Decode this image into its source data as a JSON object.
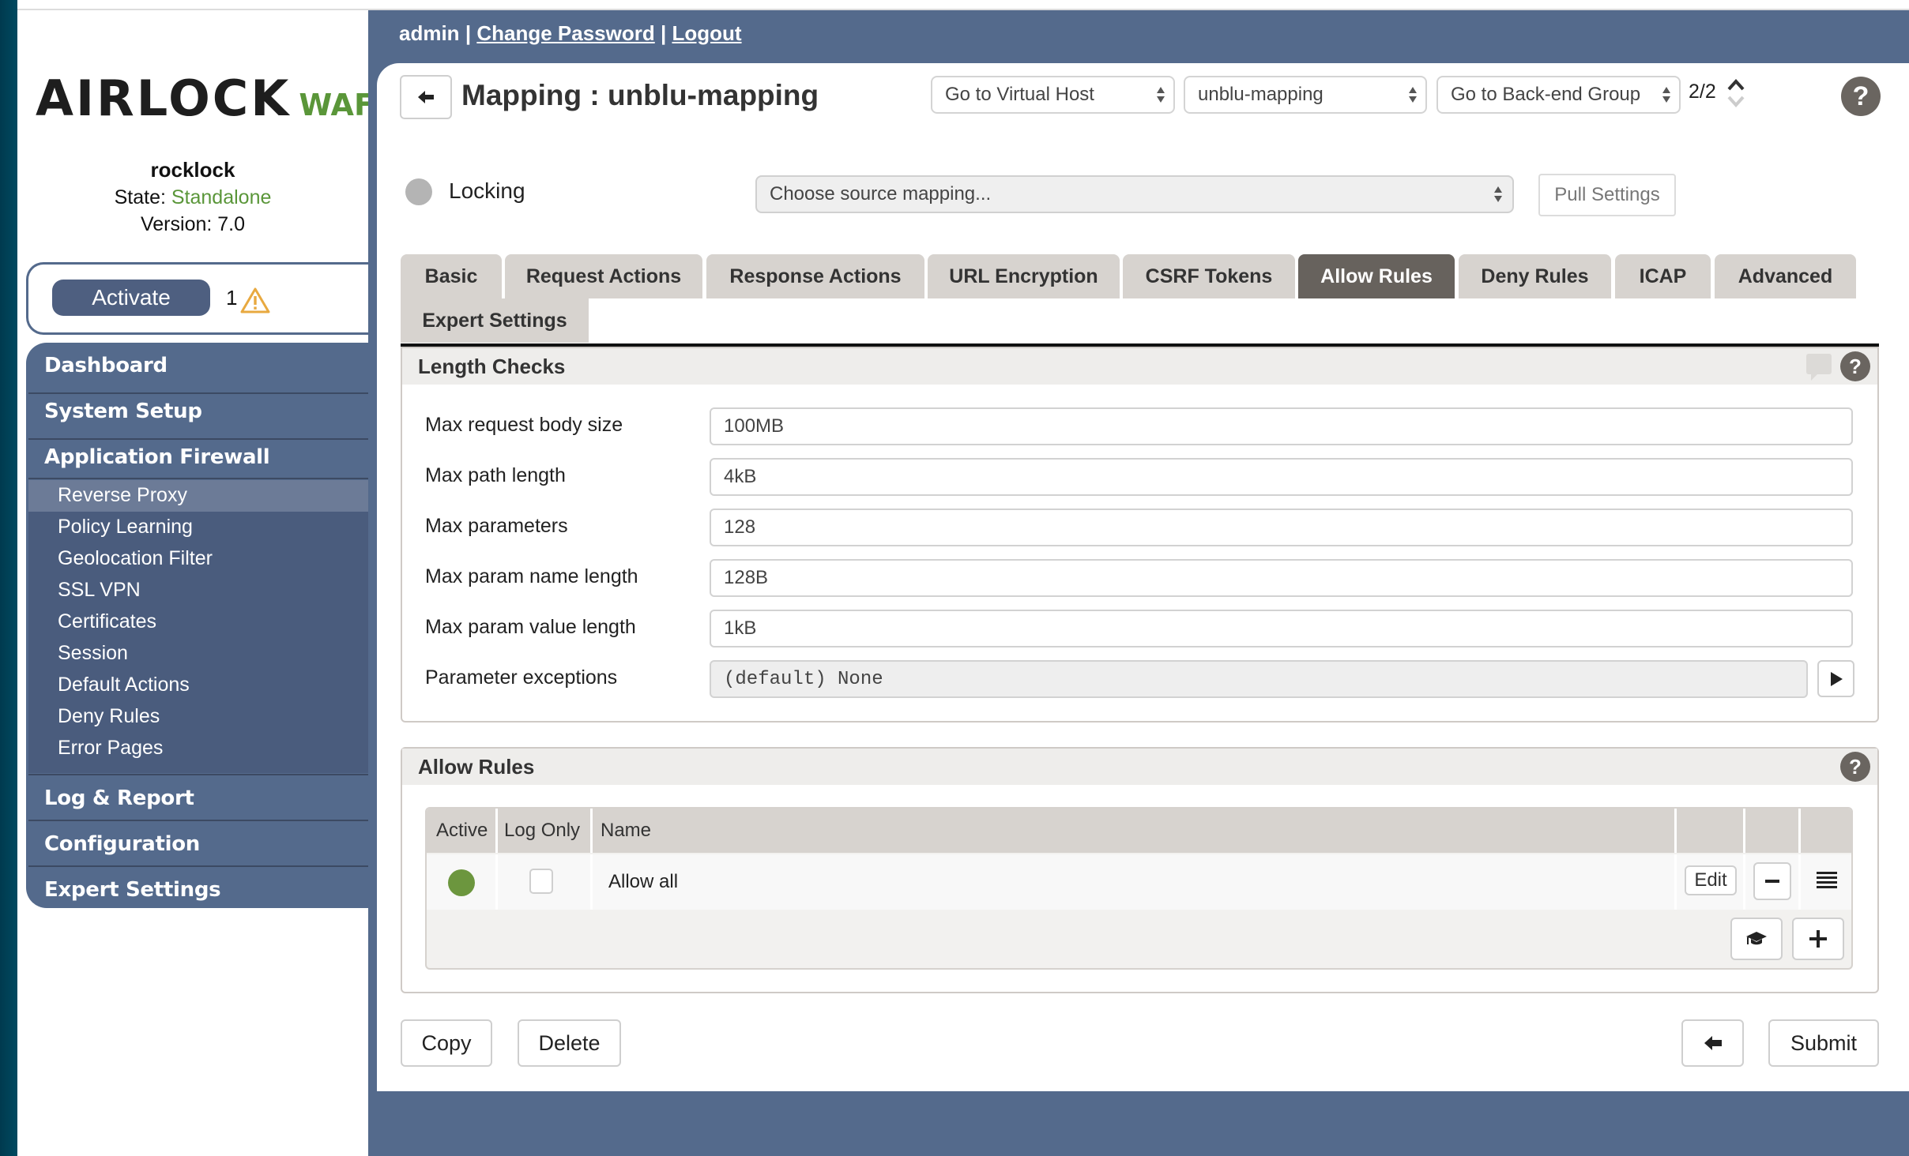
{
  "sidebar": {
    "logo": {
      "main": "AIRLOCK",
      "suffix": "WAF"
    },
    "host_name": "rocklock",
    "state_label": "State:",
    "state_value": "Standalone",
    "version": "Version: 7.0",
    "activate_label": "Activate",
    "warning_count": "1",
    "nav": [
      {
        "label": "Dashboard"
      },
      {
        "label": "System Setup"
      },
      {
        "label": "Application Firewall"
      },
      {
        "label": "Log & Report"
      },
      {
        "label": "Configuration"
      },
      {
        "label": "Expert Settings"
      }
    ],
    "sub_items": [
      {
        "label": "Reverse Proxy",
        "active": true
      },
      {
        "label": "Policy Learning"
      },
      {
        "label": "Geolocation Filter"
      },
      {
        "label": "SSL VPN"
      },
      {
        "label": "Certificates"
      },
      {
        "label": "Session"
      },
      {
        "label": "Default Actions"
      },
      {
        "label": "Deny Rules"
      },
      {
        "label": "Error Pages"
      }
    ]
  },
  "user_bar": {
    "user": "admin",
    "separator": "|",
    "change_password": "Change Password",
    "logout": "Logout"
  },
  "header": {
    "title": "Mapping : unblu-mapping",
    "virtual_host_select": "Go to Virtual Host",
    "mapping_select": "unblu-mapping",
    "backend_group_select": "Go to Back-end Group",
    "pager": "2/2",
    "help": "?"
  },
  "locking": {
    "label": "Locking",
    "source_placeholder": "Choose source mapping...",
    "pull_settings": "Pull Settings"
  },
  "tabs": [
    {
      "label": "Basic"
    },
    {
      "label": "Request Actions"
    },
    {
      "label": "Response Actions"
    },
    {
      "label": "URL Encryption"
    },
    {
      "label": "CSRF Tokens"
    },
    {
      "label": "Allow Rules",
      "active": true
    },
    {
      "label": "Deny Rules"
    },
    {
      "label": "ICAP"
    },
    {
      "label": "Advanced"
    },
    {
      "label": "Expert Settings"
    }
  ],
  "length_checks": {
    "title": "Length Checks",
    "fields": [
      {
        "label": "Max request body size",
        "value": "100MB"
      },
      {
        "label": "Max path length",
        "value": "4kB"
      },
      {
        "label": "Max parameters",
        "value": "128"
      },
      {
        "label": "Max param name length",
        "value": "128B"
      },
      {
        "label": "Max param value length",
        "value": "1kB"
      },
      {
        "label": "Parameter exceptions",
        "value": "(default) None"
      }
    ]
  },
  "allow_rules": {
    "title": "Allow Rules",
    "columns": [
      "Active",
      "Log Only",
      "Name"
    ],
    "rows": [
      {
        "active": true,
        "log_only": false,
        "name": "Allow all",
        "edit_label": "Edit"
      }
    ]
  },
  "footer": {
    "copy": "Copy",
    "delete": "Delete",
    "submit": "Submit"
  },
  "colors": {
    "brand_blue": "#546a8c",
    "brand_green": "#5a9639",
    "active_tab": "#67625d",
    "warning": "#e8a940"
  }
}
